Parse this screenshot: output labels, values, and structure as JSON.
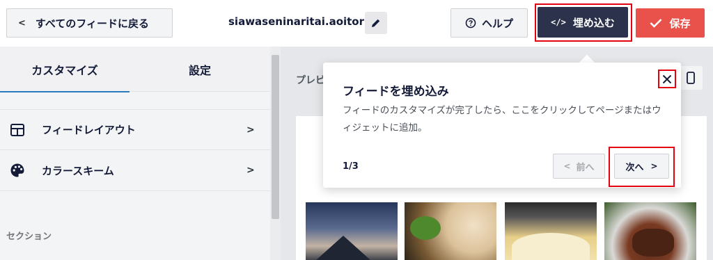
{
  "header": {
    "back_label": "すべてのフィードに戻る",
    "back_icon": "chevron-left-icon",
    "feed_name": "siawaseninaritai.aoitori",
    "edit_icon": "pencil-icon",
    "help_label": "ヘルプ",
    "help_icon": "question-circle-icon",
    "embed_label": "埋め込む",
    "embed_icon": "code-icon",
    "embed_code_glyph": "</>",
    "save_label": "保存",
    "save_icon": "checkmark-icon"
  },
  "sidebar": {
    "tabs": [
      {
        "label": "カスタマイズ",
        "active": true
      },
      {
        "label": "設定",
        "active": false
      }
    ],
    "items": [
      {
        "label": "フィードレイアウト",
        "icon": "grid-layout-icon"
      },
      {
        "label": "カラースキーム",
        "icon": "palette-icon"
      }
    ],
    "section_label": "セクション"
  },
  "preview": {
    "label": "プレビ"
  },
  "popover": {
    "title": "フィードを埋め込み",
    "description": "フィードのカスタマイズが完了したら、ここをクリックしてページまたはウィジェットに追加。",
    "step": "1/3",
    "prev_label": "前へ",
    "next_label": "次へ",
    "close_icon": "close-icon"
  },
  "colors": {
    "accent_red": "#e8524a",
    "embed_dark": "#2c324c",
    "highlight_outline": "#e3000f",
    "tab_underline": "#2a7bbd"
  }
}
